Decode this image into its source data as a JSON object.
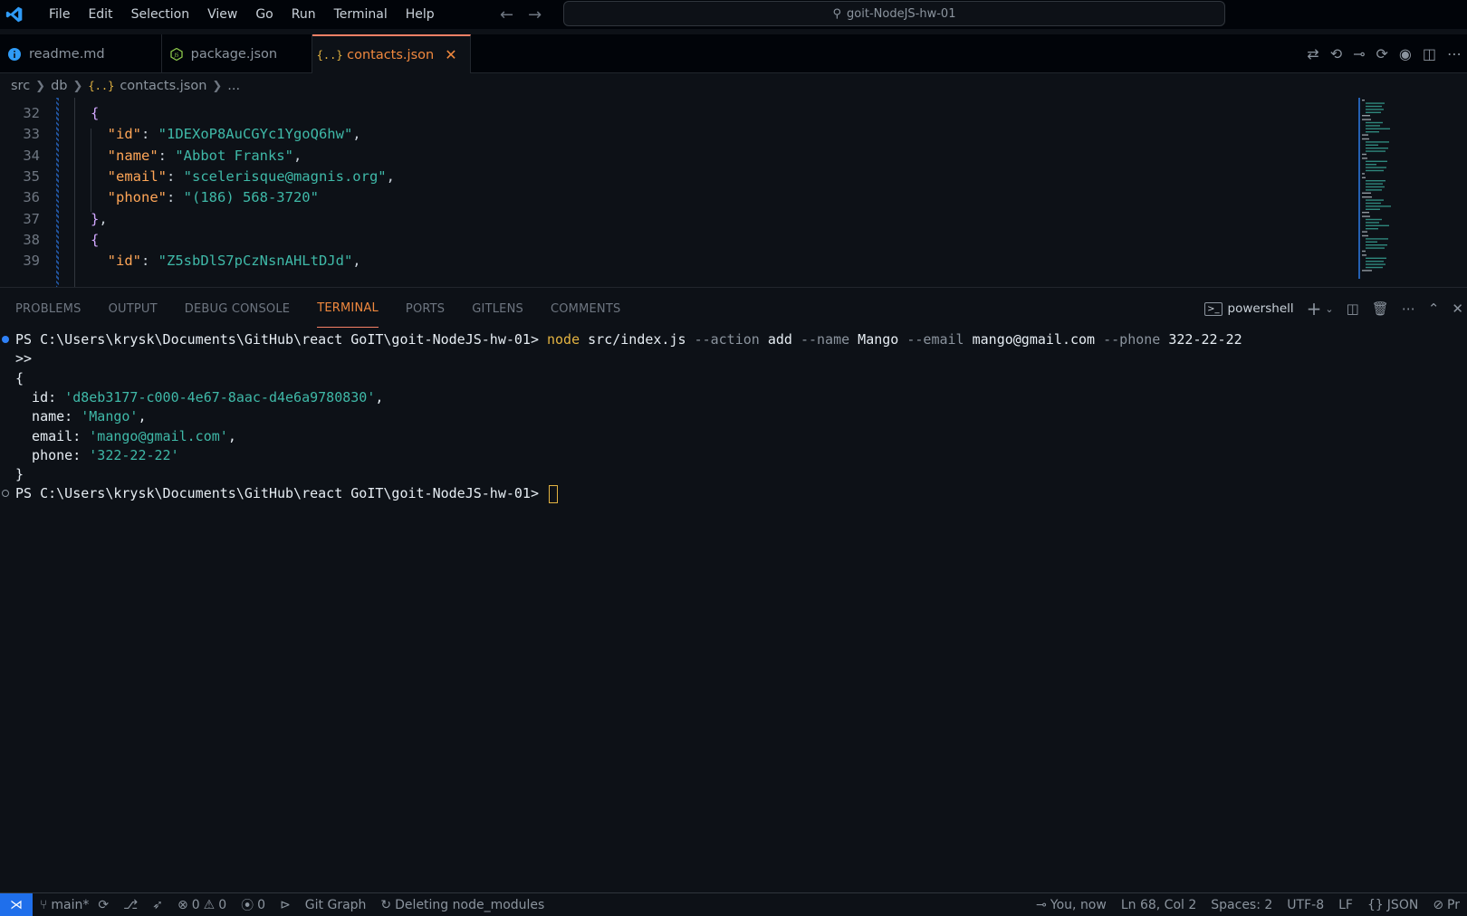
{
  "window": {
    "title": "goit-NodeJS-hw-01"
  },
  "menu": [
    "File",
    "Edit",
    "Selection",
    "View",
    "Go",
    "Run",
    "Terminal",
    "Help"
  ],
  "tabs": [
    {
      "label": "readme.md",
      "icon": "info-icon",
      "active": false
    },
    {
      "label": "package.json",
      "icon": "nodejs-icon",
      "active": false
    },
    {
      "label": "contacts.json",
      "icon": "json-braces-icon",
      "active": true
    }
  ],
  "breadcrumb": {
    "items": [
      "src",
      "db",
      "contacts.json",
      "..."
    ],
    "file_icon": "{..}"
  },
  "editor": {
    "lines": [
      {
        "n": "32",
        "indent": 1,
        "tokens": [
          {
            "t": "{",
            "c": "tk-brace"
          }
        ]
      },
      {
        "n": "33",
        "indent": 2,
        "tokens": [
          {
            "t": "\"id\"",
            "c": "tk-key"
          },
          {
            "t": ": ",
            "c": "tk-punc"
          },
          {
            "t": "\"1DEXoP8AuCGYc1YgoQ6hw\"",
            "c": "tk-str"
          },
          {
            "t": ",",
            "c": "tk-punc"
          }
        ]
      },
      {
        "n": "34",
        "indent": 2,
        "tokens": [
          {
            "t": "\"name\"",
            "c": "tk-key"
          },
          {
            "t": ": ",
            "c": "tk-punc"
          },
          {
            "t": "\"Abbot Franks\"",
            "c": "tk-str"
          },
          {
            "t": ",",
            "c": "tk-punc"
          }
        ]
      },
      {
        "n": "35",
        "indent": 2,
        "tokens": [
          {
            "t": "\"email\"",
            "c": "tk-key"
          },
          {
            "t": ": ",
            "c": "tk-punc"
          },
          {
            "t": "\"scelerisque@magnis.org\"",
            "c": "tk-str"
          },
          {
            "t": ",",
            "c": "tk-punc"
          }
        ]
      },
      {
        "n": "36",
        "indent": 2,
        "tokens": [
          {
            "t": "\"phone\"",
            "c": "tk-key"
          },
          {
            "t": ": ",
            "c": "tk-punc"
          },
          {
            "t": "\"(186) 568-3720\"",
            "c": "tk-str"
          }
        ]
      },
      {
        "n": "37",
        "indent": 1,
        "tokens": [
          {
            "t": "}",
            "c": "tk-brace"
          },
          {
            "t": ",",
            "c": "tk-punc"
          }
        ]
      },
      {
        "n": "38",
        "indent": 1,
        "tokens": [
          {
            "t": "{",
            "c": "tk-brace"
          }
        ]
      },
      {
        "n": "39",
        "indent": 2,
        "tokens": [
          {
            "t": "\"id\"",
            "c": "tk-key"
          },
          {
            "t": ": ",
            "c": "tk-punc"
          },
          {
            "t": "\"Z5sbDlS7pCzNsnAHLtDJd\"",
            "c": "tk-str"
          },
          {
            "t": ",",
            "c": "tk-punc"
          }
        ]
      }
    ]
  },
  "panel": {
    "tabs": [
      "PROBLEMS",
      "OUTPUT",
      "DEBUG CONSOLE",
      "TERMINAL",
      "PORTS",
      "GITLENS",
      "COMMENTS"
    ],
    "active_tab": "TERMINAL",
    "shell": "powershell"
  },
  "terminal": {
    "prompt": "PS C:\\Users\\krysk\\Documents\\GitHub\\react GoIT\\goit-NodeJS-hw-01> ",
    "command": {
      "node": "node",
      "script": " src/index.js ",
      "f1": "--action",
      "v1": " add ",
      "f2": "--name",
      "v2": " Mango ",
      "f3": "--email",
      "v3": " mango@gmail.com ",
      "f4": "--phone",
      "v4": " 322-22-22"
    },
    "continuation": ">>",
    "open_brace": "{",
    "close_brace": "}",
    "output": [
      {
        "key": "  id: ",
        "value": "'d8eb3177-c000-4e67-8aac-d4e6a9780830'",
        "end": ","
      },
      {
        "key": "  name: ",
        "value": "'Mango'",
        "end": ","
      },
      {
        "key": "  email: ",
        "value": "'mango@gmail.com'",
        "end": ","
      },
      {
        "key": "  phone: ",
        "value": "'322-22-22'",
        "end": ""
      }
    ]
  },
  "statusbar": {
    "branch": "main*",
    "errors": "0",
    "warnings": "0",
    "ports": "0",
    "git_graph": "Git Graph",
    "task": "Deleting node_modules",
    "blame": "You, now",
    "position": "Ln 68, Col 2",
    "spaces": "Spaces: 2",
    "encoding": "UTF-8",
    "eol": "LF",
    "language": "JSON",
    "trailing": "Pr"
  },
  "colors": {
    "accent": "#f0883e",
    "remote": "#1f6feb",
    "background": "#0d1117"
  }
}
